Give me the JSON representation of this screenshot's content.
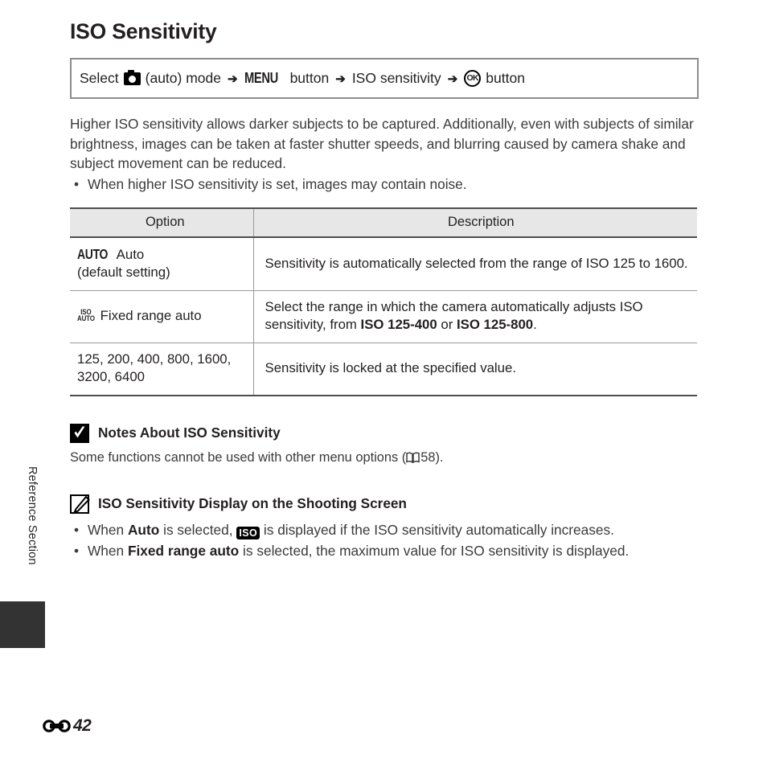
{
  "page": {
    "title": "ISO Sensitivity",
    "side_label": "Reference Section",
    "folio_mark_icon": "reference-section-mark-icon",
    "folio_number": "42"
  },
  "path_box": {
    "select_label": "Select",
    "camera_icon": "camera-auto-mode-icon",
    "auto_mode_label": "(auto) mode",
    "arrow": "➔",
    "menu_glyph": "MENU",
    "menu_button_label": "button",
    "iso_sensitivity_label": "ISO sensitivity",
    "ok_glyph": "OK",
    "ok_button_label": "button"
  },
  "intro": {
    "paragraph": "Higher ISO sensitivity allows darker subjects to be captured. Additionally, even with subjects of similar brightness, images can be taken at faster shutter speeds, and blurring caused by camera shake and subject movement can be reduced.",
    "bullet_dot": "•",
    "bullet": "When higher ISO sensitivity is set, images may contain noise."
  },
  "table": {
    "headers": {
      "option": "Option",
      "description": "Description"
    },
    "rows": [
      {
        "icon": "auto-glyph-icon",
        "glyph": "AUTO",
        "option_line1": "Auto",
        "option_line2": "(default setting)",
        "description_a": "Sensitivity is automatically selected from the range of ISO 125 to 1600.",
        "description_b": "",
        "description_bold1": "",
        "description_mid": "",
        "description_bold2": "",
        "description_end": ""
      },
      {
        "icon": "iso-auto-glyph-icon",
        "glyph_top": "ISO",
        "glyph_bottom": "AUTO",
        "option_line1": "Fixed range auto",
        "option_line2": "",
        "description_a": "Select the range in which the camera automatically adjusts ISO sensitivity, from ",
        "description_bold1": "ISO 125-400",
        "description_mid": " or ",
        "description_bold2": "ISO 125-800",
        "description_end": "."
      },
      {
        "icon": "",
        "option_line1": "125, 200, 400, 800, 1600,",
        "option_line2": "3200, 6400",
        "description_a": "Sensitivity is locked at the specified value.",
        "description_bold1": "",
        "description_mid": "",
        "description_bold2": "",
        "description_end": ""
      }
    ]
  },
  "note_caution": {
    "icon": "caution-checkmark-icon",
    "title": "Notes About ISO Sensitivity",
    "text_before": "Some functions cannot be used with other menu options (",
    "book_icon": "book-reference-icon",
    "reference_page": "58",
    "text_after": ")."
  },
  "note_tip": {
    "icon": "pencil-note-icon",
    "title": "ISO Sensitivity Display on the Shooting Screen",
    "bullet_dot": "•",
    "bullets": [
      {
        "before": "When ",
        "bold": "Auto",
        "mid": " is selected, ",
        "badge": "ISO",
        "badge_icon": "iso-display-badge-icon",
        "after": " is displayed if the ISO sensitivity automatically increases."
      },
      {
        "before": "When ",
        "bold": "Fixed range auto",
        "mid": " is selected, the maximum value for ISO sensitivity is displayed.",
        "badge": "",
        "badge_icon": "",
        "after": ""
      }
    ]
  },
  "colors": {
    "text": "#231f20",
    "body_text": "#3a3a3a",
    "table_header_bg": "#e7e7e7",
    "table_rule_heavy": "#4d4d4d",
    "table_rule_light": "#9a9a9a",
    "box_border": "#8c8c8c",
    "side_tab": "#333333"
  }
}
